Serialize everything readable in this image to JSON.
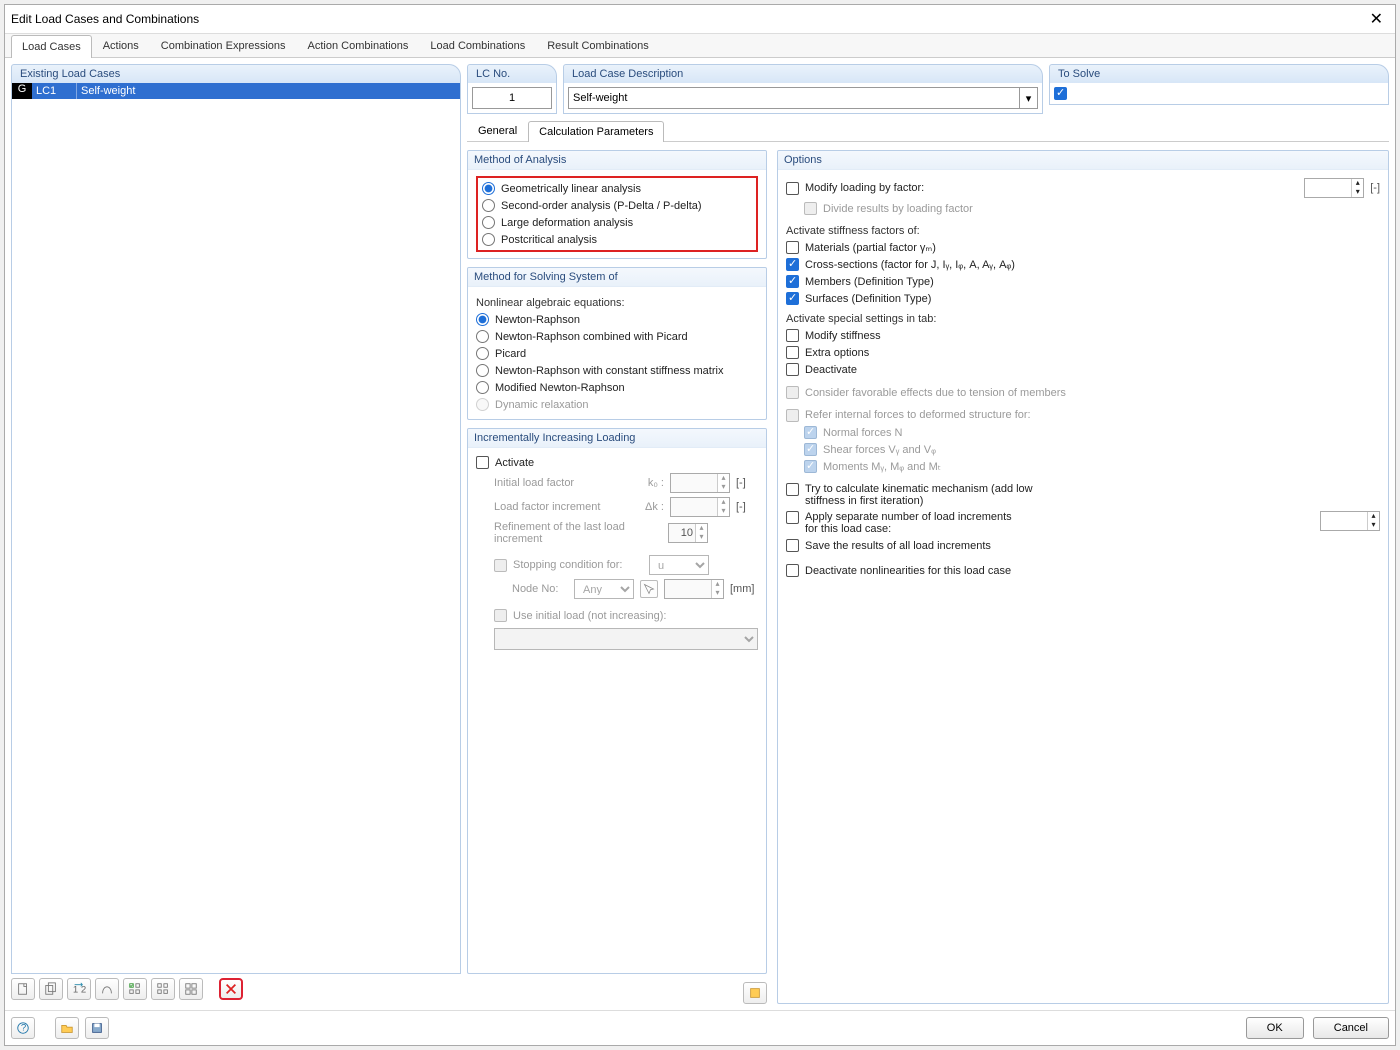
{
  "window": {
    "title": "Edit Load Cases and Combinations"
  },
  "mainTabs": [
    "Load Cases",
    "Actions",
    "Combination Expressions",
    "Action Combinations",
    "Load Combinations",
    "Result Combinations"
  ],
  "activeMainTab": 0,
  "left": {
    "header": "Existing Load Cases",
    "rows": [
      {
        "g": "G",
        "id": "LC1",
        "desc": "Self-weight",
        "selected": true
      }
    ],
    "toolbarIcons": [
      "new",
      "copy",
      "renumber",
      "link",
      "check-all",
      "uncheck-all",
      "grid",
      "delete"
    ]
  },
  "top": {
    "lcno_label": "LC No.",
    "lcno_value": "1",
    "desc_label": "Load Case Description",
    "desc_value": "Self-weight",
    "solve_label": "To Solve",
    "solve_checked": true
  },
  "subTabs": [
    "General",
    "Calculation Parameters"
  ],
  "activeSubTab": 1,
  "method_of_analysis": {
    "legend": "Method of Analysis",
    "options": [
      "Geometrically linear analysis",
      "Second-order analysis (P-Delta / P-delta)",
      "Large deformation analysis",
      "Postcritical analysis"
    ],
    "selected": 0
  },
  "solving": {
    "legend": "Method for Solving System of",
    "sub": "Nonlinear algebraic equations:",
    "options": [
      "Newton-Raphson",
      "Newton-Raphson combined with Picard",
      "Picard",
      "Newton-Raphson with constant stiffness matrix",
      "Modified Newton-Raphson",
      "Dynamic relaxation"
    ],
    "selected": 0,
    "disabled": [
      5
    ]
  },
  "incremental": {
    "legend": "Incrementally Increasing Loading",
    "activate": "Activate",
    "activate_checked": false,
    "initial_label": "Initial load factor",
    "initial_sym": "k₀ :",
    "initial_val": "",
    "increment_label": "Load factor increment",
    "increment_sym": "Δk :",
    "increment_val": "",
    "refine_label": "Refinement of the last load increment",
    "refine_val": "10",
    "stop_label": "Stopping condition for:",
    "stop_sel": "u",
    "node_label": "Node No:",
    "node_sel": "Any",
    "node_unit": "[mm]",
    "useinitial_label": "Use initial load (not increasing):"
  },
  "options": {
    "legend": "Options",
    "modify_loading": "Modify loading by factor:",
    "modify_loading_unit": "[-]",
    "divide_results": "Divide results by loading factor",
    "activate_stiff_hdr": "Activate stiffness factors of:",
    "materials": "Materials (partial factor γₘ)",
    "cross": "Cross-sections (factor for J, Iᵧ, Iᵩ, A, Aᵧ, Aᵩ)",
    "members": "Members (Definition Type)",
    "surfaces": "Surfaces (Definition Type)",
    "special_hdr": "Activate special settings in tab:",
    "modify_stiffness": "Modify stiffness",
    "extra": "Extra options",
    "deactivate": "Deactivate",
    "favorable": "Consider favorable effects due to tension of members",
    "refer_hdr": "Refer internal forces to deformed structure for:",
    "normal": "Normal forces N",
    "shear": "Shear forces Vᵧ and Vᵩ",
    "moments": "Moments Mᵧ, Mᵩ and Mₜ",
    "kinematic": "Try to calculate kinematic mechanism (add low stiffness in first iteration)",
    "apply_sep": "Apply separate number of load increments for this load case:",
    "save_results": "Save the results of all load increments",
    "deact_nonlin": "Deactivate nonlinearities for this load case"
  },
  "footer": {
    "ok": "OK",
    "cancel": "Cancel"
  }
}
